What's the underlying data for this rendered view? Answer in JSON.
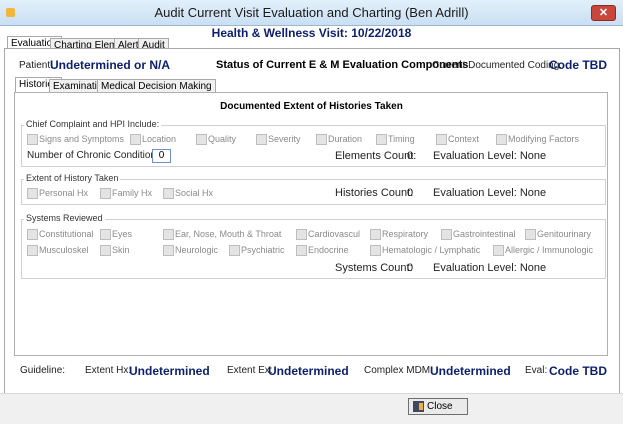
{
  "window": {
    "title": "Audit Current Visit Evaluation and Charting (Ben Adrill)",
    "close_glyph": "✕"
  },
  "visit_title": "Health & Wellness Visit: 10/22/2018",
  "main_tabs": [
    "Evaluation",
    "Charting Elements",
    "Alerts",
    "Audit"
  ],
  "header": {
    "patient_label": "Patient:",
    "patient_value": "Undetermined or N/A",
    "status_title": "Status of Current E & M Evaluation Components",
    "coding_label": "Current Documented Coding:",
    "coding_value": "Code TBD"
  },
  "sub_tabs": [
    "Histories",
    "Examinations",
    "Medical Decision Making"
  ],
  "section_title": "Documented Extent of Histories Taken",
  "chief_complaint": {
    "title": "Chief Complaint and HPI Include:",
    "items": [
      "Signs and Symptoms",
      "Location",
      "Quality",
      "Severity",
      "Duration",
      "Timing",
      "Context",
      "Modifying Factors"
    ],
    "chronic_label": "Number of Chronic Conditions:",
    "chronic_value": "0",
    "count_label": "Elements Count:",
    "count_value": "0",
    "eval_label": "Evaluation Level: None"
  },
  "history_taken": {
    "title": "Extent of History Taken",
    "items": [
      "Personal Hx",
      "Family Hx",
      "Social Hx"
    ],
    "count_label": "Histories Count:",
    "count_value": "0",
    "eval_label": "Evaluation Level: None"
  },
  "systems": {
    "title": "Systems Reviewed",
    "row1": [
      "Constitutional",
      "Eyes",
      "Ear, Nose, Mouth & Throat",
      "Cardiovascul",
      "Respiratory",
      "Gastrointestinal",
      "Genitourinary"
    ],
    "row2": [
      "Musculoskel",
      "Skin",
      "Neurologic",
      "Psychiatric",
      "Endocrine",
      "Hematologic / Lymphatic",
      "Allergic / Immunologic"
    ],
    "count_label": "Systems Count:",
    "count_value": "0",
    "eval_label": "Evaluation Level: None"
  },
  "footer": {
    "guideline_label": "Guideline:",
    "extent_hx_label": "Extent Hx:",
    "extent_hx_value": "Undetermined",
    "extent_ex_label": "Extent Ex:",
    "extent_ex_value": "Undetermined",
    "complex_mdm_label": "Complex MDM:",
    "complex_mdm_value": "Undetermined",
    "eval_label": "Eval:",
    "eval_value": "Code TBD"
  },
  "close_button": "Close"
}
